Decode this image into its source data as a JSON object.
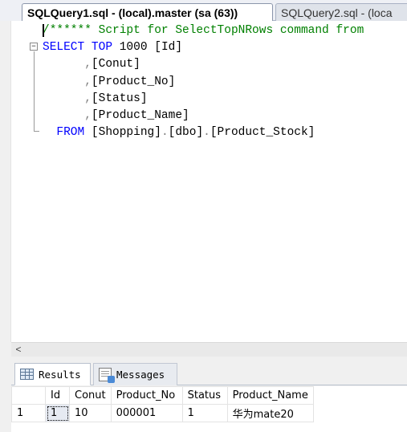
{
  "tabs": [
    {
      "label": "SQLQuery1.sql - (local).master (sa (63))"
    },
    {
      "label": "SQLQuery2.sql - (loca"
    }
  ],
  "editor": {
    "lines": [
      [
        {
          "t": "/****** Script for SelectTopNRows command from",
          "c": "cm"
        }
      ],
      [
        {
          "t": "SELECT",
          "c": "kw"
        },
        {
          "t": " ",
          "c": "id"
        },
        {
          "t": "TOP",
          "c": "kw"
        },
        {
          "t": " 1000 ",
          "c": "num"
        },
        {
          "t": "[Id]",
          "c": "id"
        }
      ],
      [
        {
          "t": "      ",
          "c": "id"
        },
        {
          "t": ",",
          "c": "op"
        },
        {
          "t": "[Conut]",
          "c": "id"
        }
      ],
      [
        {
          "t": "      ",
          "c": "id"
        },
        {
          "t": ",",
          "c": "op"
        },
        {
          "t": "[Product_No]",
          "c": "id"
        }
      ],
      [
        {
          "t": "      ",
          "c": "id"
        },
        {
          "t": ",",
          "c": "op"
        },
        {
          "t": "[Status]",
          "c": "id"
        }
      ],
      [
        {
          "t": "      ",
          "c": "id"
        },
        {
          "t": ",",
          "c": "op"
        },
        {
          "t": "[Product_Name]",
          "c": "id"
        }
      ],
      [
        {
          "t": "  ",
          "c": "id"
        },
        {
          "t": "FROM",
          "c": "kw"
        },
        {
          "t": " [Shopping]",
          "c": "id"
        },
        {
          "t": ".",
          "c": "op"
        },
        {
          "t": "[dbo]",
          "c": "id"
        },
        {
          "t": ".",
          "c": "op"
        },
        {
          "t": "[Product_Stock]",
          "c": "id"
        }
      ]
    ],
    "fold_marker": "−",
    "scroll_left_arrow": "<"
  },
  "results": {
    "tabs": [
      {
        "label": "Results",
        "icon": "grid-icon"
      },
      {
        "label": "Messages",
        "icon": "messages-icon"
      }
    ],
    "columns": [
      "",
      "Id",
      "Conut",
      "Product_No",
      "Status",
      "Product_Name"
    ],
    "rows": [
      [
        "1",
        "1",
        "10",
        "000001",
        "1",
        "华为mate20"
      ]
    ]
  },
  "colors": {
    "keyword": "#0000ff",
    "comment": "#008000",
    "operator": "#808080"
  }
}
